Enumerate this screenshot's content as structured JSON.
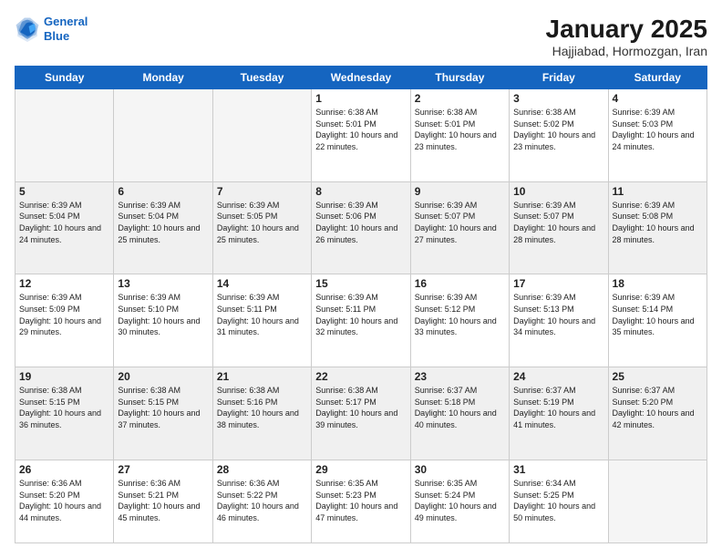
{
  "logo": {
    "line1": "General",
    "line2": "Blue"
  },
  "title": "January 2025",
  "subtitle": "Hajjiabad, Hormozgan, Iran",
  "weekdays": [
    "Sunday",
    "Monday",
    "Tuesday",
    "Wednesday",
    "Thursday",
    "Friday",
    "Saturday"
  ],
  "weeks": [
    [
      {
        "day": "",
        "empty": true
      },
      {
        "day": "",
        "empty": true
      },
      {
        "day": "",
        "empty": true
      },
      {
        "day": "1",
        "sunrise": "6:38 AM",
        "sunset": "5:01 PM",
        "daylight": "10 hours and 22 minutes."
      },
      {
        "day": "2",
        "sunrise": "6:38 AM",
        "sunset": "5:01 PM",
        "daylight": "10 hours and 23 minutes."
      },
      {
        "day": "3",
        "sunrise": "6:38 AM",
        "sunset": "5:02 PM",
        "daylight": "10 hours and 23 minutes."
      },
      {
        "day": "4",
        "sunrise": "6:39 AM",
        "sunset": "5:03 PM",
        "daylight": "10 hours and 24 minutes."
      }
    ],
    [
      {
        "day": "5",
        "sunrise": "6:39 AM",
        "sunset": "5:04 PM",
        "daylight": "10 hours and 24 minutes."
      },
      {
        "day": "6",
        "sunrise": "6:39 AM",
        "sunset": "5:04 PM",
        "daylight": "10 hours and 25 minutes."
      },
      {
        "day": "7",
        "sunrise": "6:39 AM",
        "sunset": "5:05 PM",
        "daylight": "10 hours and 25 minutes."
      },
      {
        "day": "8",
        "sunrise": "6:39 AM",
        "sunset": "5:06 PM",
        "daylight": "10 hours and 26 minutes."
      },
      {
        "day": "9",
        "sunrise": "6:39 AM",
        "sunset": "5:07 PM",
        "daylight": "10 hours and 27 minutes."
      },
      {
        "day": "10",
        "sunrise": "6:39 AM",
        "sunset": "5:07 PM",
        "daylight": "10 hours and 28 minutes."
      },
      {
        "day": "11",
        "sunrise": "6:39 AM",
        "sunset": "5:08 PM",
        "daylight": "10 hours and 28 minutes."
      }
    ],
    [
      {
        "day": "12",
        "sunrise": "6:39 AM",
        "sunset": "5:09 PM",
        "daylight": "10 hours and 29 minutes."
      },
      {
        "day": "13",
        "sunrise": "6:39 AM",
        "sunset": "5:10 PM",
        "daylight": "10 hours and 30 minutes."
      },
      {
        "day": "14",
        "sunrise": "6:39 AM",
        "sunset": "5:11 PM",
        "daylight": "10 hours and 31 minutes."
      },
      {
        "day": "15",
        "sunrise": "6:39 AM",
        "sunset": "5:11 PM",
        "daylight": "10 hours and 32 minutes."
      },
      {
        "day": "16",
        "sunrise": "6:39 AM",
        "sunset": "5:12 PM",
        "daylight": "10 hours and 33 minutes."
      },
      {
        "day": "17",
        "sunrise": "6:39 AM",
        "sunset": "5:13 PM",
        "daylight": "10 hours and 34 minutes."
      },
      {
        "day": "18",
        "sunrise": "6:39 AM",
        "sunset": "5:14 PM",
        "daylight": "10 hours and 35 minutes."
      }
    ],
    [
      {
        "day": "19",
        "sunrise": "6:38 AM",
        "sunset": "5:15 PM",
        "daylight": "10 hours and 36 minutes."
      },
      {
        "day": "20",
        "sunrise": "6:38 AM",
        "sunset": "5:15 PM",
        "daylight": "10 hours and 37 minutes."
      },
      {
        "day": "21",
        "sunrise": "6:38 AM",
        "sunset": "5:16 PM",
        "daylight": "10 hours and 38 minutes."
      },
      {
        "day": "22",
        "sunrise": "6:38 AM",
        "sunset": "5:17 PM",
        "daylight": "10 hours and 39 minutes."
      },
      {
        "day": "23",
        "sunrise": "6:37 AM",
        "sunset": "5:18 PM",
        "daylight": "10 hours and 40 minutes."
      },
      {
        "day": "24",
        "sunrise": "6:37 AM",
        "sunset": "5:19 PM",
        "daylight": "10 hours and 41 minutes."
      },
      {
        "day": "25",
        "sunrise": "6:37 AM",
        "sunset": "5:20 PM",
        "daylight": "10 hours and 42 minutes."
      }
    ],
    [
      {
        "day": "26",
        "sunrise": "6:36 AM",
        "sunset": "5:20 PM",
        "daylight": "10 hours and 44 minutes."
      },
      {
        "day": "27",
        "sunrise": "6:36 AM",
        "sunset": "5:21 PM",
        "daylight": "10 hours and 45 minutes."
      },
      {
        "day": "28",
        "sunrise": "6:36 AM",
        "sunset": "5:22 PM",
        "daylight": "10 hours and 46 minutes."
      },
      {
        "day": "29",
        "sunrise": "6:35 AM",
        "sunset": "5:23 PM",
        "daylight": "10 hours and 47 minutes."
      },
      {
        "day": "30",
        "sunrise": "6:35 AM",
        "sunset": "5:24 PM",
        "daylight": "10 hours and 49 minutes."
      },
      {
        "day": "31",
        "sunrise": "6:34 AM",
        "sunset": "5:25 PM",
        "daylight": "10 hours and 50 minutes."
      },
      {
        "day": "",
        "empty": true
      }
    ]
  ]
}
